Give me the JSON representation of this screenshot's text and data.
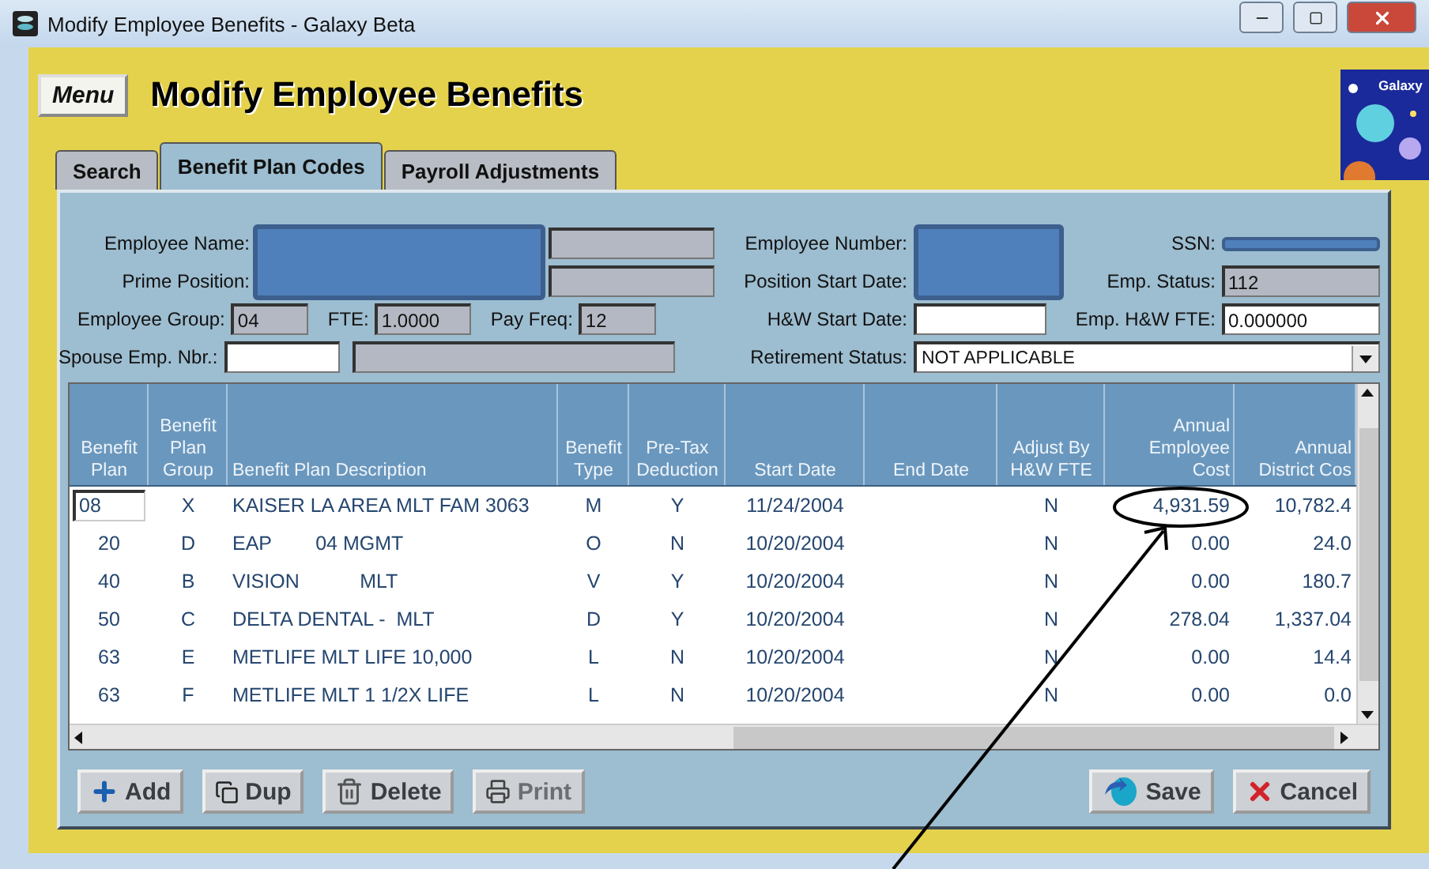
{
  "window": {
    "title": "Modify Employee Benefits - Galaxy Beta"
  },
  "menu_button": "Menu",
  "page_title": "Modify Employee Benefits",
  "logo_text": "Galaxy",
  "tabs": [
    {
      "label": "Search",
      "selected": false
    },
    {
      "label": "Benefit Plan Codes",
      "selected": true
    },
    {
      "label": "Payroll Adjustments",
      "selected": false
    }
  ],
  "form": {
    "employee_name_label": "Employee Name:",
    "prime_position_label": "Prime Position:",
    "employee_group": {
      "label": "Employee Group:",
      "value": "04"
    },
    "fte": {
      "label": "FTE:",
      "value": "1.0000"
    },
    "pay_freq": {
      "label": "Pay Freq:",
      "value": "12"
    },
    "spouse_emp_nbr": {
      "label": "Spouse Emp. Nbr.:"
    },
    "employee_number_label": "Employee Number:",
    "position_start_date_label": "Position Start Date:",
    "ssn_label": "SSN:",
    "emp_status": {
      "label": "Emp. Status:",
      "value": "112"
    },
    "hw_start_date": {
      "label": "H&W Start Date:"
    },
    "emp_hw_fte": {
      "label": "Emp. H&W FTE:",
      "value": "0.000000"
    },
    "retirement_status": {
      "label": "Retirement Status:",
      "value": "NOT APPLICABLE"
    }
  },
  "table": {
    "columns": [
      {
        "label": "Benefit\nPlan"
      },
      {
        "label": "Benefit\nPlan\nGroup"
      },
      {
        "label": "Benefit Plan Description"
      },
      {
        "label": "Benefit\nType"
      },
      {
        "label": "Pre-Tax\nDeduction"
      },
      {
        "label": "Start Date"
      },
      {
        "label": "End Date"
      },
      {
        "label": "Adjust By\nH&W FTE"
      },
      {
        "label": "Annual\nEmployee\nCost"
      },
      {
        "label": "Annual\nDistrict Cos"
      }
    ],
    "rows": [
      {
        "selected": true,
        "cells": [
          "08",
          "X",
          "KAISER LA AREA MLT FAM 3063",
          "M",
          "Y",
          "11/24/2004",
          "",
          "N",
          "4,931.59",
          "10,782.4"
        ]
      },
      {
        "selected": false,
        "cells": [
          "20",
          "D",
          "EAP        04 MGMT",
          "O",
          "N",
          "10/20/2004",
          "",
          "N",
          "0.00",
          "24.0"
        ]
      },
      {
        "selected": false,
        "cells": [
          "40",
          "B",
          "VISION           MLT",
          "V",
          "Y",
          "10/20/2004",
          "",
          "N",
          "0.00",
          "180.7"
        ]
      },
      {
        "selected": false,
        "cells": [
          "50",
          "C",
          "DELTA DENTAL -  MLT",
          "D",
          "Y",
          "10/20/2004",
          "",
          "N",
          "278.04",
          "1,337.04"
        ]
      },
      {
        "selected": false,
        "cells": [
          "63",
          "E",
          "METLIFE MLT LIFE 10,000",
          "L",
          "N",
          "10/20/2004",
          "",
          "N",
          "0.00",
          "14.4"
        ]
      },
      {
        "selected": false,
        "cells": [
          "63",
          "F",
          "METLIFE MLT 1 1/2X LIFE",
          "L",
          "N",
          "10/20/2004",
          "",
          "N",
          "0.00",
          "0.0"
        ]
      }
    ]
  },
  "left_buttons": [
    {
      "kind": "add",
      "label": "Add",
      "disabled": false
    },
    {
      "kind": "duplicate",
      "label": "Dup",
      "disabled": false
    },
    {
      "kind": "delete",
      "label": "Delete",
      "disabled": false
    },
    {
      "kind": "print",
      "label": "Print",
      "disabled": true
    }
  ],
  "right_buttons": [
    {
      "kind": "save",
      "label": "Save",
      "disabled": false
    },
    {
      "kind": "cancel",
      "label": "Cancel",
      "disabled": false
    }
  ]
}
